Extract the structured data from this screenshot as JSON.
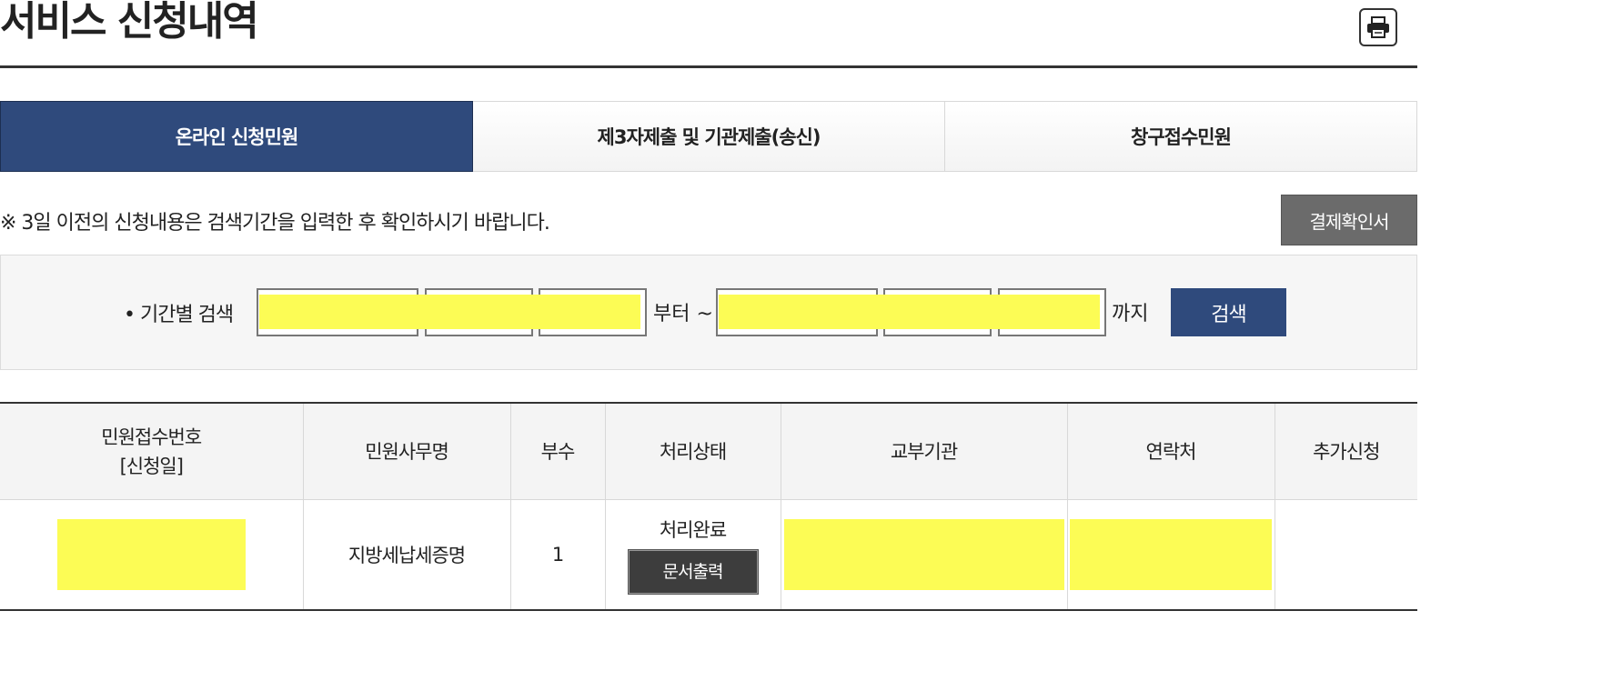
{
  "page": {
    "title": "서비스 신청내역"
  },
  "tabs": [
    {
      "label": "온라인 신청민원",
      "active": true
    },
    {
      "label": "제3자제출 및 기관제출(송신)",
      "active": false
    },
    {
      "label": "창구접수민원",
      "active": false
    }
  ],
  "notice": "※ 3일 이전의 신청내용은 검색기간을 입력한 후 확인하시기 바랍니다.",
  "receipt_button": "결제확인서",
  "search": {
    "label": "• 기간별 검색",
    "from_suffix": "부터 ~",
    "to_suffix": "까지",
    "button": "검색",
    "from_year": "",
    "from_month": "",
    "from_day": "",
    "to_year": "",
    "to_month": "",
    "to_day": ""
  },
  "table": {
    "headers": {
      "receipt_no_line1": "민원접수번호",
      "receipt_no_line2": "[신청일]",
      "office_name": "민원사무명",
      "copies": "부수",
      "status": "처리상태",
      "issuing_agency": "교부기관",
      "contact": "연락처",
      "additional": "추가신청"
    },
    "rows": [
      {
        "receipt_no": "",
        "office_name": "지방세납세증명",
        "copies": "1",
        "status": "처리완료",
        "print_button": "문서출력",
        "issuing_agency": "",
        "contact": "",
        "additional": ""
      }
    ]
  },
  "colors": {
    "primary": "#2f4a7c",
    "highlight": "#fcfc55",
    "dark_button": "#3d3d3d",
    "gray_button": "#6b6b6b"
  },
  "icons": {
    "print": "printer-icon"
  }
}
